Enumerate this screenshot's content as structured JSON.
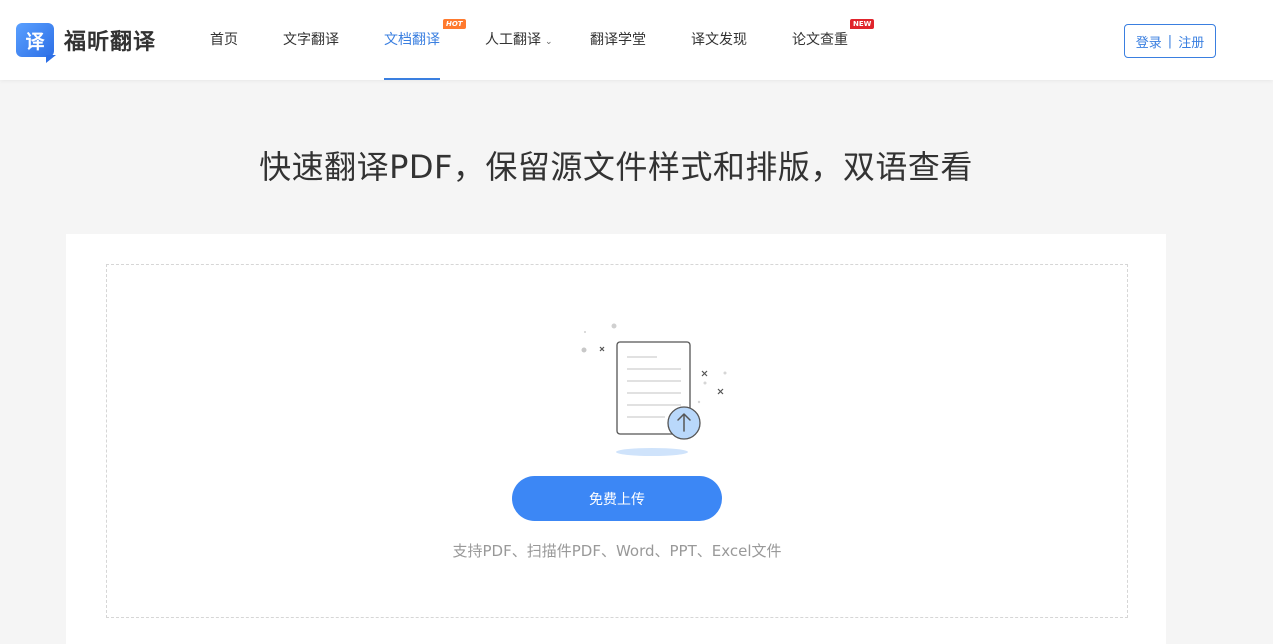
{
  "brand": {
    "logo_glyph": "译",
    "name": "福昕翻译",
    "accent": "#3a7fe0"
  },
  "nav": {
    "items": [
      {
        "label": "首页"
      },
      {
        "label": "文字翻译"
      },
      {
        "label": "文档翻译",
        "active": true,
        "badge": "HOT"
      },
      {
        "label": "人工翻译",
        "dropdown": true
      },
      {
        "label": "翻译学堂"
      },
      {
        "label": "译文发现"
      },
      {
        "label": "论文查重",
        "badge": "NEW"
      }
    ],
    "auth": {
      "login": "登录",
      "separator": "|",
      "register": "注册"
    }
  },
  "hero": {
    "headline": "快速翻译PDF，保留源文件样式和排版，双语查看"
  },
  "upload": {
    "button_label": "免费上传",
    "supported_formats": "支持PDF、扫描件PDF、Word、PPT、Excel文件",
    "button_color": "#3c87f5"
  }
}
